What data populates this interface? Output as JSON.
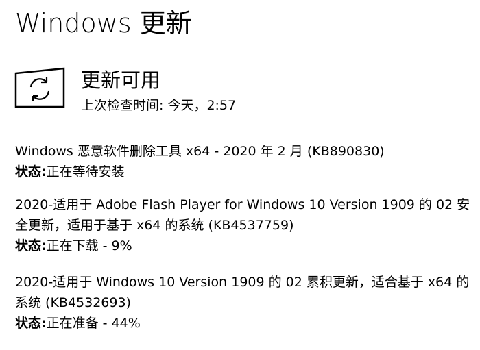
{
  "page": {
    "title": "Windows 更新"
  },
  "status": {
    "icon": "sync-arrows-icon",
    "heading": "更新可用",
    "last_checked": "上次检查时间: 今天，2:57"
  },
  "updates": [
    {
      "title": "Windows 恶意软件删除工具 x64 - 2020 年 2 月 (KB890830)",
      "status_label": "状态:",
      "status_value": "正在等待安装"
    },
    {
      "title": "2020-适用于 Adobe Flash Player for Windows 10 Version 1909 的 02 安全更新，适用于基于 x64 的系统 (KB4537759)",
      "status_label": "状态:",
      "status_value": "正在下载 - 9%"
    },
    {
      "title": "2020-适用于 Windows 10 Version 1909 的 02 累积更新，适合基于 x64 的系统 (KB4532693)",
      "status_label": "状态:",
      "status_value": "正在准备 - 44%"
    }
  ]
}
